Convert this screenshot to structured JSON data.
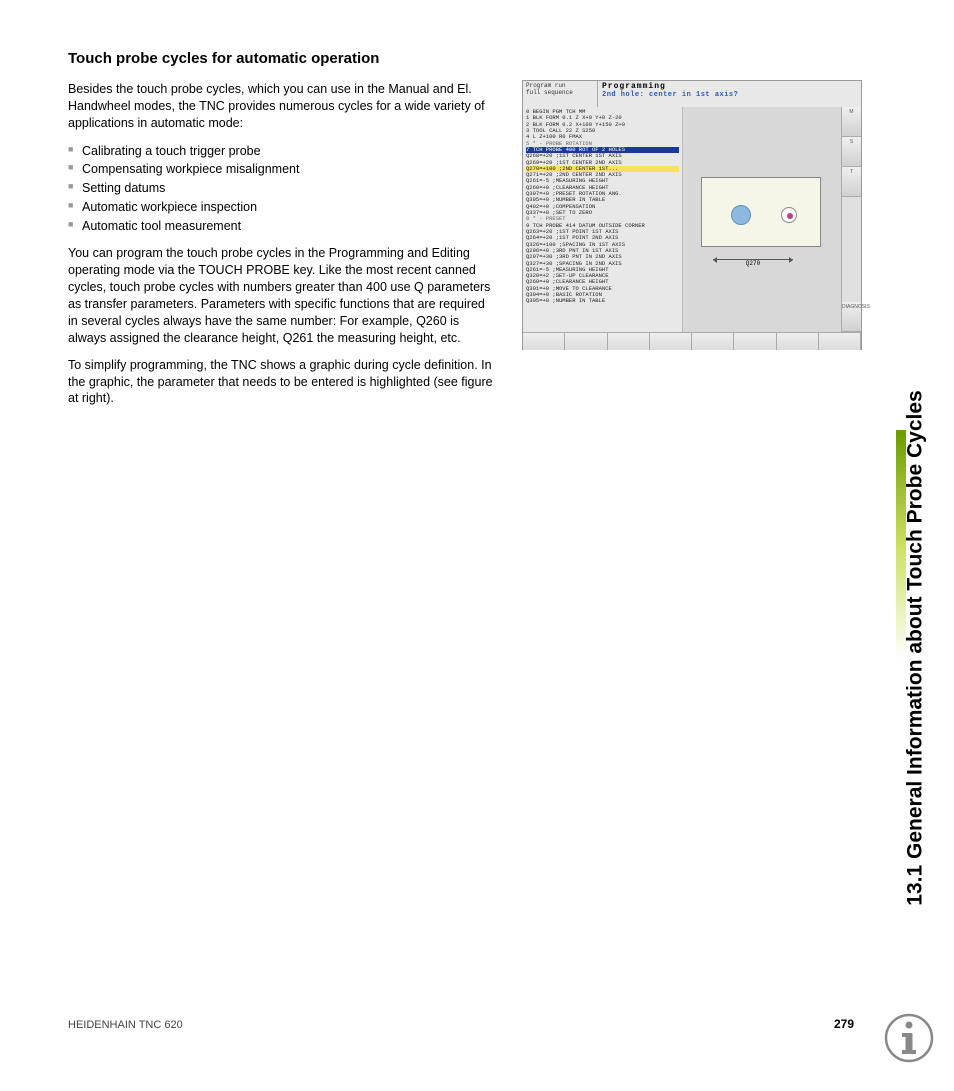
{
  "heading": "Touch probe cycles for automatic operation",
  "para1": "Besides the touch probe cycles, which you can use in the Manual and El. Handwheel modes, the TNC provides numerous cycles for a wide variety of applications in automatic mode:",
  "bullets": [
    "Calibrating a touch trigger probe",
    "Compensating workpiece misalignment",
    "Setting datums",
    "Automatic workpiece inspection",
    "Automatic tool measurement"
  ],
  "para2": "You can program the touch probe cycles in the Programming and Editing operating mode via the TOUCH PROBE key. Like the most recent canned cycles, touch probe cycles with numbers greater than 400 use Q parameters as transfer parameters. Parameters with specific functions that are required in several cycles always have the same number: For example, Q260 is always assigned the clearance height, Q261 the measuring height, etc.",
  "para3": "To simplify programming, the TNC shows a graphic during cycle definition. In the graphic, the parameter that needs to be entered is highlighted (see figure at right).",
  "figure": {
    "modeLine1": "Program run",
    "modeLine2": "full sequence",
    "title": "Programming",
    "subtitle": "2nd hole: center in 1st axis?",
    "dimLabel": "Q270",
    "sidebar": {
      "m": "M",
      "s": "S",
      "t": "T",
      "diagnosis": "DIAGNOSIS"
    },
    "code": {
      "l0": "0  BEGIN PGM TCH MM",
      "l1": "1  BLK FORM 0.1 Z X+0 Y+0 Z-20",
      "l2": "2  BLK FORM 0.2  X+100  Y+150  Z+0",
      "l3": "3  TOOL CALL 22 Z S250",
      "l4": "4  L  Z+100 R0 FMAX",
      "l5": "5  * -  PROBE ROTATION",
      "l7": "7  TCH PROBE 400 ROT OF 2 HOLES",
      "q268": "   Q268=+20    ;1ST CENTER 1ST AXIS",
      "q269": "   Q269=+20    ;1ST CENTER 2ND AXIS",
      "q270": "   Q270=+100   ;2ND CENTER 1ST...",
      "q271": "   Q271=+20    ;2ND CENTER 2ND AXIS",
      "q261": "   Q261=-5     ;MEASURING HEIGHT",
      "q260": "   Q260=+0     ;CLEARANCE HEIGHT",
      "q307": "   Q307=+0     ;PRESET ROTATION ANG.",
      "q305": "   Q305=+0     ;NUMBER IN TABLE",
      "q402": "   Q402=+0     ;COMPENSATION",
      "q337": "   Q337=+0     ;SET TO ZERO",
      "l8": "8  * -  PRESET",
      "l9": "9  TCH PROBE 414 DATUM OUTSIDE CORNER",
      "q263": "   Q263=+20    ;1ST POINT 1ST AXIS",
      "q264": "   Q264=+20    ;1ST POINT 2ND AXIS",
      "q326": "   Q326=+100   ;SPACING IN 1ST AXIS",
      "q296": "   Q296=+0     ;3RD PNT IN 1ST AXIS",
      "q297": "   Q297=+30    ;3RD PNT IN 2ND AXIS",
      "q327": "   Q327=+30    ;SPACING IN 2ND AXIS",
      "q261b": "   Q261=-5     ;MEASURING HEIGHT",
      "q320": "   Q320=+2     ;SET-UP CLEARANCE",
      "q260b": "   Q260=+0     ;CLEARANCE HEIGHT",
      "q301": "   Q301=+0     ;MOVE TO CLEARANCE",
      "q304": "   Q304=+0     ;BASIC ROTATION",
      "q305b": "   Q305=+0     ;NUMBER IN TABLE"
    }
  },
  "sideTitle": "13.1 General Information about Touch Probe Cycles",
  "footerLeft": "HEIDENHAIN TNC 620",
  "pageNumber": "279"
}
